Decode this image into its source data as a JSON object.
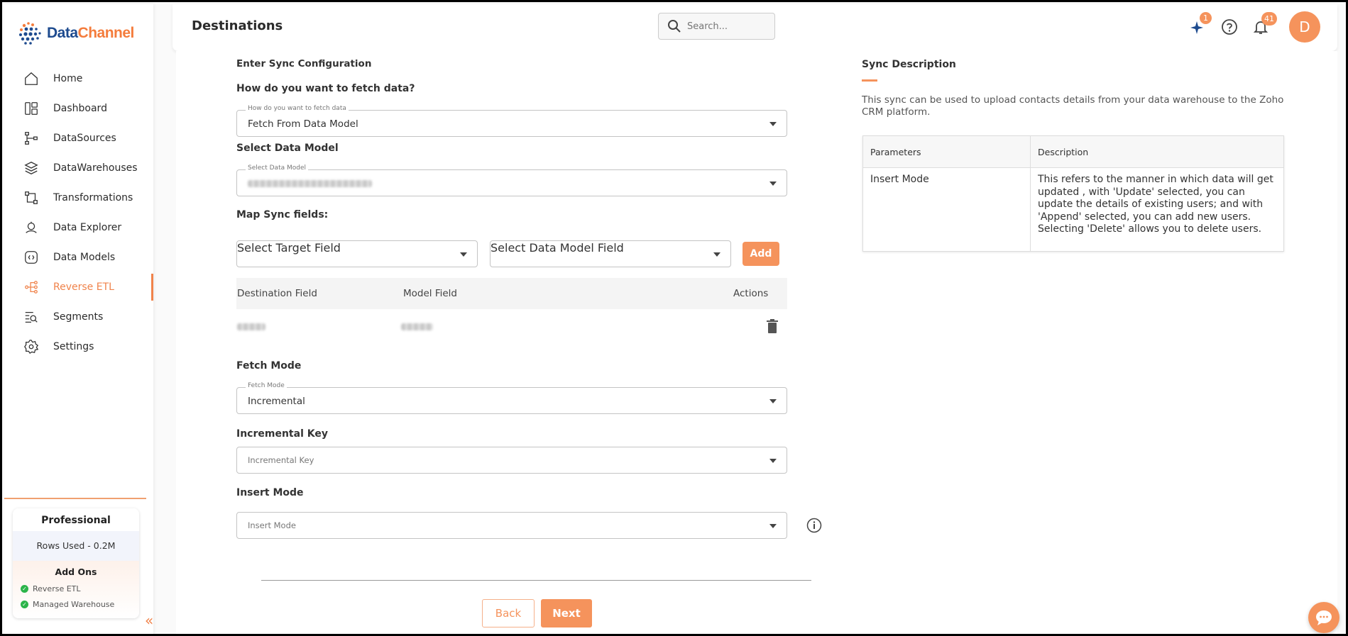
{
  "app": {
    "brand_part1": "Data",
    "brand_part2": "Channel"
  },
  "sidebar": {
    "items": [
      {
        "label": "Home",
        "icon": "home-icon"
      },
      {
        "label": "Dashboard",
        "icon": "dashboard-icon"
      },
      {
        "label": "DataSources",
        "icon": "datasources-icon"
      },
      {
        "label": "DataWarehouses",
        "icon": "datawarehouses-icon"
      },
      {
        "label": "Transformations",
        "icon": "transformations-icon"
      },
      {
        "label": "Data Explorer",
        "icon": "data-explorer-icon"
      },
      {
        "label": "Data Models",
        "icon": "data-models-icon"
      },
      {
        "label": "Reverse ETL",
        "icon": "reverse-etl-icon",
        "active": true
      },
      {
        "label": "Segments",
        "icon": "segments-icon"
      },
      {
        "label": "Settings",
        "icon": "settings-icon"
      }
    ],
    "plan": {
      "name": "Professional",
      "rows_used": "Rows Used - 0.2M",
      "addons_title": "Add Ons",
      "addons": [
        "Reverse ETL",
        "Managed Warehouse"
      ]
    },
    "collapse_glyph": "«"
  },
  "header": {
    "title": "Destinations",
    "search_placeholder": "Search...",
    "sparkle_badge": "1",
    "notifications_badge": "41",
    "avatar_initial": "D"
  },
  "form": {
    "section_title": "Enter Sync Configuration",
    "fetch_question": "How do you want to fetch data?",
    "fetch_floating": "How do you want to fetch data",
    "fetch_value": "Fetch From Data Model",
    "data_model_label": "Select Data Model",
    "data_model_floating": "Select Data Model",
    "map_fields_label": "Map Sync fields:",
    "target_field_placeholder": "Select Target Field",
    "model_field_placeholder": "Select Data Model Field",
    "add_label": "Add",
    "table": {
      "headers": [
        "Destination Field",
        "Model Field",
        "Actions"
      ]
    },
    "fetch_mode_label": "Fetch Mode",
    "fetch_mode_floating": "Fetch Mode",
    "fetch_mode_value": "Incremental",
    "incremental_key_label": "Incremental Key",
    "incremental_key_placeholder": "Incremental Key",
    "insert_mode_label": "Insert Mode",
    "insert_mode_placeholder": "Insert Mode",
    "back_label": "Back",
    "next_label": "Next"
  },
  "description": {
    "title": "Sync Description",
    "text": "This sync can be used to upload contacts details from your data warehouse to the Zoho CRM platform.",
    "table_headers": [
      "Parameters",
      "Description"
    ],
    "rows": [
      {
        "parameter": "Insert Mode",
        "description": "This refers to the manner in which data will get updated , with 'Update' selected, you can update the details of existing users; and with 'Append' selected, you can add new users. Selecting 'Delete' allows you to delete users."
      }
    ]
  },
  "colors": {
    "accent": "#f5935c",
    "brand_blue": "#1e4b8f",
    "brand_orange": "#f47c3c"
  }
}
